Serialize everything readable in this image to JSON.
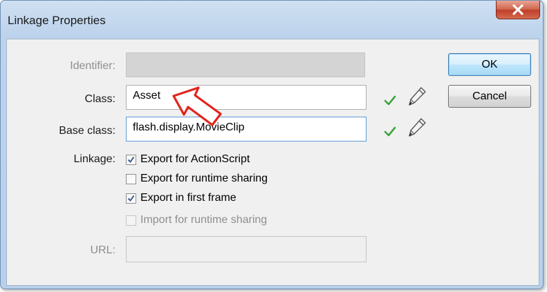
{
  "window": {
    "title": "Linkage Properties",
    "close_symbol": "X"
  },
  "identifier": {
    "label": "Identifier:",
    "value": ""
  },
  "class_field": {
    "label": "Class:",
    "value": "Asset"
  },
  "base_class_field": {
    "label": "Base class:",
    "value": "flash.display.MovieClip"
  },
  "linkage": {
    "label": "Linkage:",
    "options": [
      {
        "label": "Export for ActionScript",
        "checked": true,
        "enabled": true
      },
      {
        "label": "Export for runtime sharing",
        "checked": false,
        "enabled": true
      },
      {
        "label": "Export in first frame",
        "checked": true,
        "enabled": true
      },
      {
        "label": "Import for runtime sharing",
        "checked": false,
        "enabled": false
      }
    ]
  },
  "url_field": {
    "label": "URL:",
    "value": ""
  },
  "buttons": {
    "ok": "OK",
    "cancel": "Cancel"
  },
  "icons": {
    "validate": "check-icon",
    "edit": "pencil-icon",
    "annotation": "red-arrow-icon"
  },
  "colors": {
    "check": "#3aa53a",
    "arrow": "#e0241c",
    "close_button": "#c7432b"
  }
}
